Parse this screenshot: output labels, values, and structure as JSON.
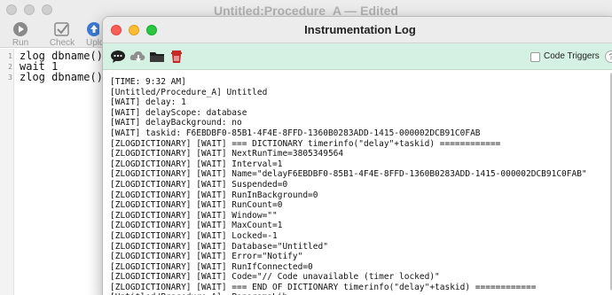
{
  "back_window": {
    "title": "Untitled:Procedure_A — Edited",
    "toolbar": [
      {
        "label": "Run",
        "icon": "play-icon"
      },
      {
        "label": "Check",
        "icon": "check-icon"
      },
      {
        "label": "Uplo",
        "icon": "upload-icon"
      }
    ],
    "code_lines": [
      {
        "num": "1",
        "text": "zlog dbname()"
      },
      {
        "num": "2",
        "text": "wait 1"
      },
      {
        "num": "3",
        "text": "zlog dbname()"
      }
    ]
  },
  "log_window": {
    "title": "Instrumentation Log",
    "toolbar": {
      "icons": [
        "chat-bubble-icon",
        "cloud-download-icon",
        "folder-icon",
        "trash-icon"
      ],
      "code_triggers_label": "Code Triggers",
      "code_triggers_checked": false,
      "help_label": "?"
    },
    "lines": [
      "[TIME: 9:32 AM]",
      "[Untitled/Procedure_A] Untitled",
      "[WAIT] delay: 1",
      "[WAIT] delayScope: database",
      "[WAIT] delayBackground: no",
      "[WAIT] taskid: F6EBDBF0-85B1-4F4E-8FFD-1360B0283ADD-1415-000002DCB91C0FAB",
      "[ZLOGDICTIONARY] [WAIT] === DICTIONARY timerinfo(\"delay\"+taskid) ============",
      "[ZLOGDICTIONARY] [WAIT] NextRunTime=3805349564",
      "[ZLOGDICTIONARY] [WAIT] Interval=1",
      "[ZLOGDICTIONARY] [WAIT] Name=\"delayF6EBDBF0-85B1-4F4E-8FFD-1360B0283ADD-1415-000002DCB91C0FAB\"",
      "[ZLOGDICTIONARY] [WAIT] Suspended=0",
      "[ZLOGDICTIONARY] [WAIT] RunInBackground=0",
      "[ZLOGDICTIONARY] [WAIT] RunCount=0",
      "[ZLOGDICTIONARY] [WAIT] Window=\"\"",
      "[ZLOGDICTIONARY] [WAIT] MaxCount=1",
      "[ZLOGDICTIONARY] [WAIT] Locked=-1",
      "[ZLOGDICTIONARY] [WAIT] Database=\"Untitled\"",
      "[ZLOGDICTIONARY] [WAIT] Error=\"Notify\"",
      "[ZLOGDICTIONARY] [WAIT] RunIfConnected=0",
      "[ZLOGDICTIONARY] [WAIT] Code=\"// Code unavailable (timer locked)\"",
      "[ZLOGDICTIONARY] [WAIT] === END OF DICTIONARY timerinfo(\"delay\"+taskid) ============",
      "[Untitled/Procedure_A] _PanoramaLib"
    ]
  },
  "colors": {
    "log_toolbar_bg": "#d4f1e3",
    "close": "#fe5f57",
    "minimize": "#febc2e",
    "zoom": "#28c840",
    "trash": "#c62828"
  }
}
